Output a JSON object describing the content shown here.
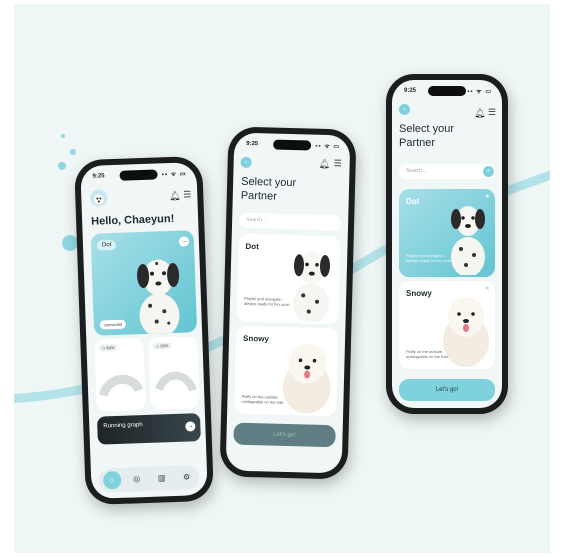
{
  "colors": {
    "accent": "#7fd2dd",
    "teal_dark": "#3aa7b8",
    "bg": "#eef6f6",
    "ink": "#1f2a2c"
  },
  "phone_left": {
    "status": {
      "time": "9:25",
      "icons": "▪▪ ᯤ ▭"
    },
    "greeting": "Hello, Chaeyun!",
    "hero": {
      "name": "Dot",
      "status": "connected"
    },
    "devices": [
      {
        "battery": "64%"
      },
      {
        "battery": "63%"
      }
    ],
    "graph_label": "Running graph",
    "nav": [
      {
        "icon": "home-icon",
        "glyph": "⌂"
      },
      {
        "icon": "target-icon",
        "glyph": "◎"
      },
      {
        "icon": "chart-icon",
        "glyph": "▥"
      },
      {
        "icon": "settings-icon",
        "glyph": "⚙"
      }
    ]
  },
  "phone_center": {
    "status": {
      "time": "9:25",
      "icons": "▪▪ ᯤ ▭"
    },
    "title": "Select your Partner",
    "search_placeholder": "Search...",
    "cards": [
      {
        "name": "Dot",
        "desc": "Playful and energetic - always ready for fun runs!"
      },
      {
        "name": "Snowy",
        "desc": "Fluffy on the outside, unstoppable on the trail."
      }
    ],
    "cta": "Let's go!"
  },
  "phone_right": {
    "status": {
      "time": "9:25",
      "icons": "▪▪ ᯤ ▭"
    },
    "title": "Select your Partner",
    "search_placeholder": "Search...",
    "cards": [
      {
        "name": "Dot",
        "desc": "Playful and energetic - always ready for fun runs!"
      },
      {
        "name": "Snowy",
        "desc": "Fluffy on the outside, unstoppable on the trail."
      }
    ],
    "cta": "Let's go!"
  }
}
